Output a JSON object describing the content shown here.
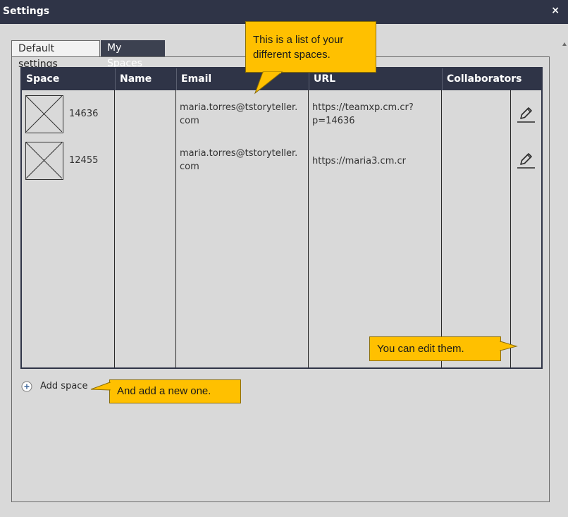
{
  "window": {
    "title": "Settings",
    "close_label": "×"
  },
  "tabs": [
    {
      "label": "Default settings",
      "active": false
    },
    {
      "label": "My Spaces",
      "active": true
    }
  ],
  "table": {
    "columns": [
      "Space",
      "Name",
      "Email",
      "URL",
      "Collaborators"
    ],
    "rows": [
      {
        "space": "14636",
        "name": "",
        "email_line1": "maria.torres@tstoryteller.",
        "email_line2": "com",
        "url_line1": "https://teamxp.cm.cr?",
        "url_line2": "p=14636",
        "thumb_icon": "image-placeholder-icon",
        "action_icon": "pencil-icon"
      },
      {
        "space": "12455",
        "name": "",
        "email_line1": "maria.torres@tstoryteller.",
        "email_line2": "com",
        "url_line1": "https://maria3.cm.cr",
        "url_line2": "",
        "thumb_icon": "image-placeholder-icon",
        "action_icon": "pencil-icon"
      }
    ]
  },
  "add_space": {
    "label": "Add space",
    "icon": "plus-circle-icon"
  },
  "callouts": {
    "list_line1": "This is a list of your",
    "list_line2": "different spaces.",
    "edit": "You can edit them.",
    "add": "And add a new one."
  },
  "colors": {
    "titlebar": "#2f3447",
    "header": "#2f3447",
    "background": "#d9d9d9",
    "callout": "#ffc000",
    "active_tab": "#3c4150"
  }
}
